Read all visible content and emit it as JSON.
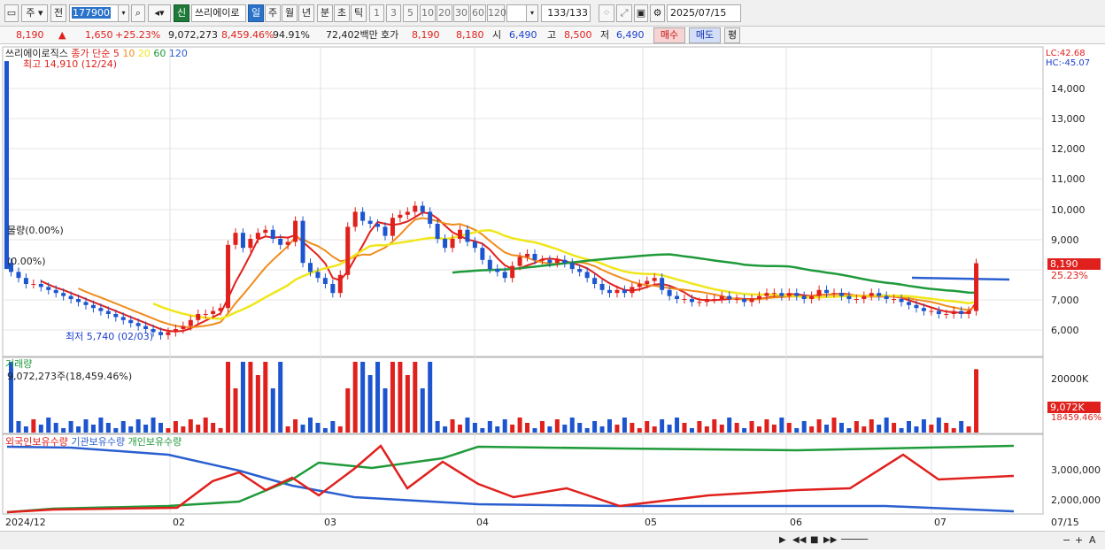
{
  "toolbar": {
    "market": "주",
    "prev": "전",
    "code": "177900",
    "name_badge": "신",
    "stock_name": "쓰리에이로",
    "periods": [
      "일",
      "주",
      "월",
      "년",
      "분",
      "초",
      "틱"
    ],
    "intervals": [
      "1",
      "3",
      "5",
      "10",
      "20",
      "30",
      "60",
      "120"
    ],
    "count": "133",
    "count_total": "/133",
    "date": "2025/07/15"
  },
  "quote": {
    "price": "8,190",
    "change": "1,650",
    "change_pct": "+25.23%",
    "volume": "9,072,273",
    "volume_pct": "8,459.46%",
    "ratio": "94.91%",
    "amount": "72,402백만",
    "ask_label": "호가",
    "ask1": "8,190",
    "ask2": "8,180",
    "open_label": "시",
    "open": "6,490",
    "high_label": "고",
    "high": "8,500",
    "low_label": "저",
    "low": "6,490",
    "buy": "매수",
    "sell": "매도",
    "avg": "평"
  },
  "price_panel": {
    "title": "쓰리에이로직스",
    "ma_label": "종가 단순",
    "ma_periods": [
      "5",
      "10",
      "20",
      "60",
      "120"
    ],
    "ma_colors": [
      "#e0201c",
      "#f08c1c",
      "#f0e61c",
      "#1f9a3a",
      "#2a5fd0"
    ],
    "high_note": "최고 14,910 (12/24)",
    "low_note": "최저 5,740 (02/03)",
    "lc": "LC:42.68",
    "hc": "HC:-45.07",
    "left_note1": "물량(0.00%)",
    "left_note2": "(0.00%)",
    "last_price": "8,190",
    "last_pct": "25.23%",
    "y_ticks": [
      "14,000",
      "13,000",
      "12,000",
      "11,000",
      "10,000",
      "9,000",
      "8,000",
      "7,000",
      "6,000"
    ]
  },
  "volume_panel": {
    "title": "거래량",
    "value_note": "9,072,273주(18,459.46%)",
    "y_tick": "20000K",
    "tag_value": "9,072K",
    "tag_pct": "18459.46%"
  },
  "holding_panel": {
    "legend": [
      "외국인보유수량",
      "기관보유수량",
      "개인보유수량"
    ],
    "legend_colors": [
      "#e0201c",
      "#2a5fd0",
      "#1f9a3a"
    ],
    "y_ticks": [
      "3,000,000",
      "2,000,000"
    ]
  },
  "x_axis": {
    "labels": [
      "2024/12",
      "02",
      "03",
      "04",
      "05",
      "06",
      "07"
    ],
    "right_label": "07/15"
  },
  "chart_data": {
    "type": "candlestick",
    "title": "쓰리에이로직스",
    "ylim": [
      5200,
      15000
    ],
    "last": 8190,
    "high_point": {
      "value": 14910,
      "date": "12/24"
    },
    "low_point": {
      "value": 5740,
      "date": "02/03"
    },
    "month_labels": [
      "2024/12",
      "02",
      "03",
      "04",
      "05",
      "06",
      "07"
    ]
  }
}
